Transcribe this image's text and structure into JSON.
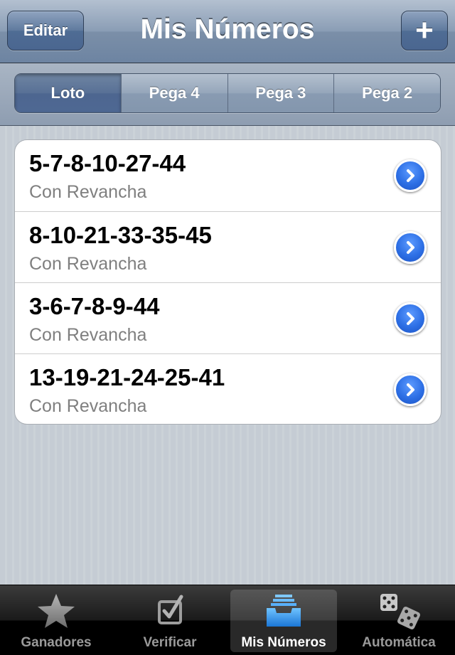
{
  "nav": {
    "title": "Mis Números",
    "edit_label": "Editar",
    "add_label": "+"
  },
  "segments": [
    {
      "label": "Loto",
      "selected": true
    },
    {
      "label": "Pega 4",
      "selected": false
    },
    {
      "label": "Pega 3",
      "selected": false
    },
    {
      "label": "Pega 2",
      "selected": false
    }
  ],
  "rows": [
    {
      "numbers": "5-7-8-10-27-44",
      "detail": "Con Revancha"
    },
    {
      "numbers": "8-10-21-33-35-45",
      "detail": "Con Revancha"
    },
    {
      "numbers": "3-6-7-8-9-44",
      "detail": "Con Revancha"
    },
    {
      "numbers": "13-19-21-24-25-41",
      "detail": "Con Revancha"
    }
  ],
  "tabs": [
    {
      "label": "Ganadores",
      "icon": "star-icon",
      "active": false
    },
    {
      "label": "Verificar",
      "icon": "checkbox-icon",
      "active": false
    },
    {
      "label": "Mis Números",
      "icon": "inbox-tray-icon",
      "active": true
    },
    {
      "label": "Automática",
      "icon": "dice-icon",
      "active": false
    }
  ],
  "colors": {
    "nav_blue": "#6d84a2",
    "disclosure_blue": "#2d6fe5",
    "subtitle_gray": "#7f7f7f"
  }
}
